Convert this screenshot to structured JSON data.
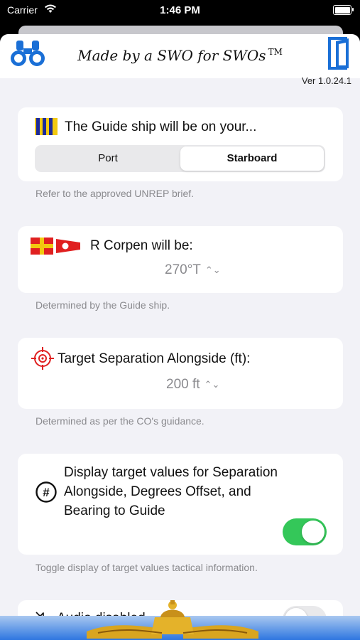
{
  "status_bar": {
    "carrier": "Carrier",
    "time": "1:46 PM"
  },
  "header": {
    "tagline": "Made by a SWO for SWOs",
    "trademark": "TM",
    "version": "Ver 1.0.24.1"
  },
  "guide_ship": {
    "title": "The Guide ship will be on your...",
    "options": [
      "Port",
      "Starboard"
    ],
    "selected": "Starboard",
    "note": "Refer to the approved UNREP brief."
  },
  "corpen": {
    "title": "R Corpen will be:",
    "value": "270°T",
    "note": "Determined by the Guide ship."
  },
  "separation": {
    "title": "Target Separation Alongside (ft):",
    "value": "200 ft",
    "note": "Determined as per the CO's guidance."
  },
  "display_targets": {
    "lines": [
      "Display target values for Separation",
      "Alongside, Degrees Offset, and",
      "Bearing to Guide"
    ],
    "enabled": true,
    "note": "Toggle display of target values tactical information."
  },
  "audio": {
    "title": "Audio disabled",
    "enabled": false
  },
  "colors": {
    "accent_blue": "#1a6fd6",
    "toggle_on": "#34c759",
    "flag_red": "#e02020",
    "flag_yellow": "#f2c80f"
  },
  "icons": [
    "wifi-icon",
    "battery-icon",
    "binoculars-icon",
    "book-icon",
    "guide-flag-icon",
    "romeo-flag-icon",
    "corpen-pennant-icon",
    "target-icon",
    "number-sign-icon",
    "speaker-muted-icon"
  ]
}
